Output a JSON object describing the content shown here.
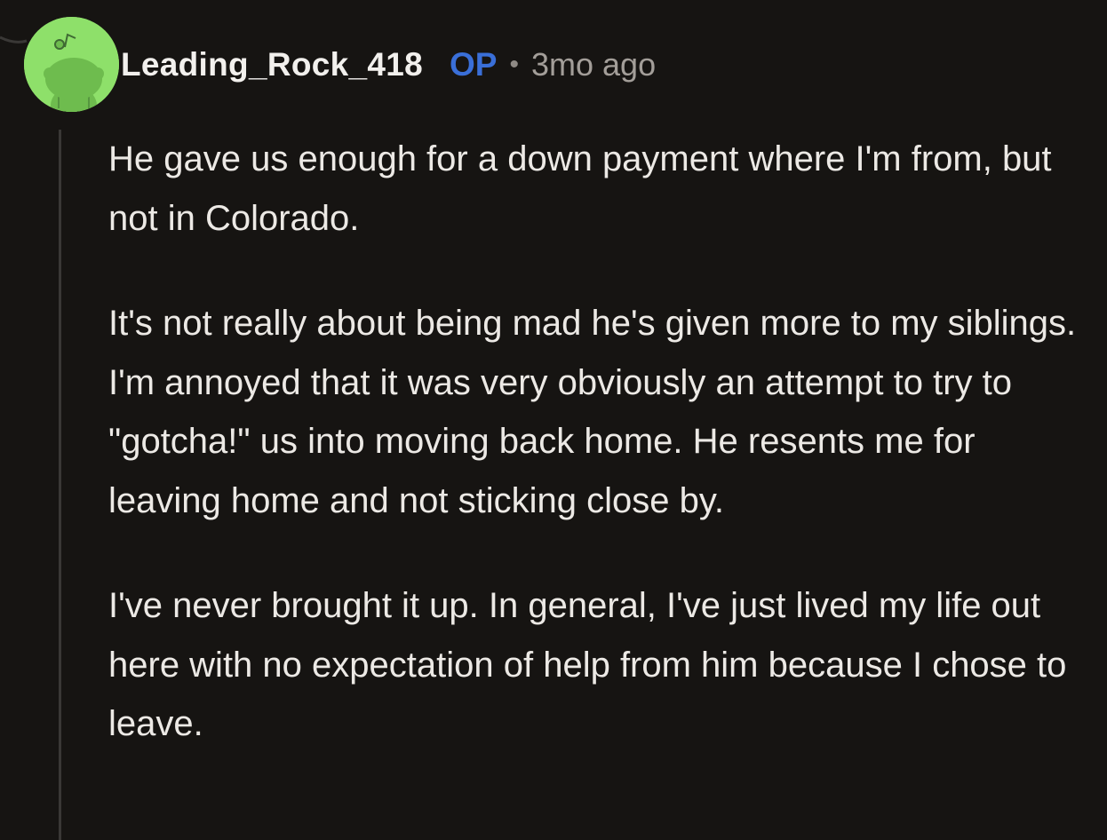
{
  "comment": {
    "author": {
      "username": "Leading_Rock_418",
      "avatar_icon": "snoo-avatar-icon",
      "avatar_bg": "#8ee06a"
    },
    "op_badge": "OP",
    "separator": "•",
    "timestamp": "3mo ago",
    "paragraphs": [
      "He gave us enough for a down payment where I'm from, but not in Colorado.",
      "It's not really about being mad he's given more to my siblings. I'm annoyed that it was very obviously an attempt to try to \"gotcha!\" us into moving back home. He resents me for leaving home and not sticking close by.",
      "I've never brought it up. In general, I've just lived my life out here with no expectation of help from him because I chose to leave."
    ]
  },
  "colors": {
    "background": "#161412",
    "op_accent": "#3a6fd8",
    "thread_line": "#3a3836"
  }
}
